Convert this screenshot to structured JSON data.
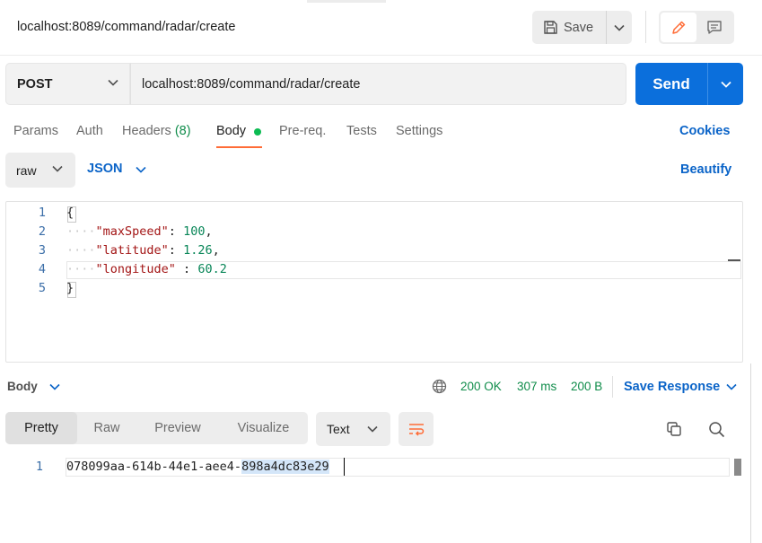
{
  "header": {
    "request_title": "localhost:8089/command/radar/create",
    "save_label": "Save"
  },
  "request": {
    "method": "POST",
    "url": "localhost:8089/command/radar/create",
    "send_label": "Send"
  },
  "tabs": {
    "params": "Params",
    "auth": "Auth",
    "headers": "Headers",
    "headers_count": "(8)",
    "body": "Body",
    "prereq": "Pre-req.",
    "tests": "Tests",
    "settings": "Settings",
    "cookies": "Cookies"
  },
  "body_options": {
    "mode": "raw",
    "language": "JSON",
    "beautify": "Beautify"
  },
  "editor": {
    "line_numbers": [
      "1",
      "2",
      "3",
      "4",
      "5"
    ],
    "open_brace": "{",
    "close_brace": "}",
    "fields": [
      {
        "key": "\"maxSpeed\"",
        "sep": ": ",
        "value": "100",
        "trail": ","
      },
      {
        "key": "\"latitude\"",
        "sep": ": ",
        "value": "1.26",
        "trail": ","
      },
      {
        "key": "\"longitude\"",
        "sep": " : ",
        "value": "60.2",
        "trail": ""
      }
    ]
  },
  "response": {
    "section_label": "Body",
    "status": "200 OK",
    "time": "307 ms",
    "size": "200 B",
    "save_response": "Save Response",
    "views": [
      "Pretty",
      "Raw",
      "Preview",
      "Visualize"
    ],
    "format": "Text",
    "line_number": "1",
    "body_plain": "078099aa-614b-44e1-aee4-",
    "body_selected": "898a4dc83e29"
  },
  "colors": {
    "accent_send": "#0b6fdc",
    "link_blue": "#0b64c8",
    "status_green": "#0f8c4a",
    "body_tab_underline": "#ff6c37"
  }
}
